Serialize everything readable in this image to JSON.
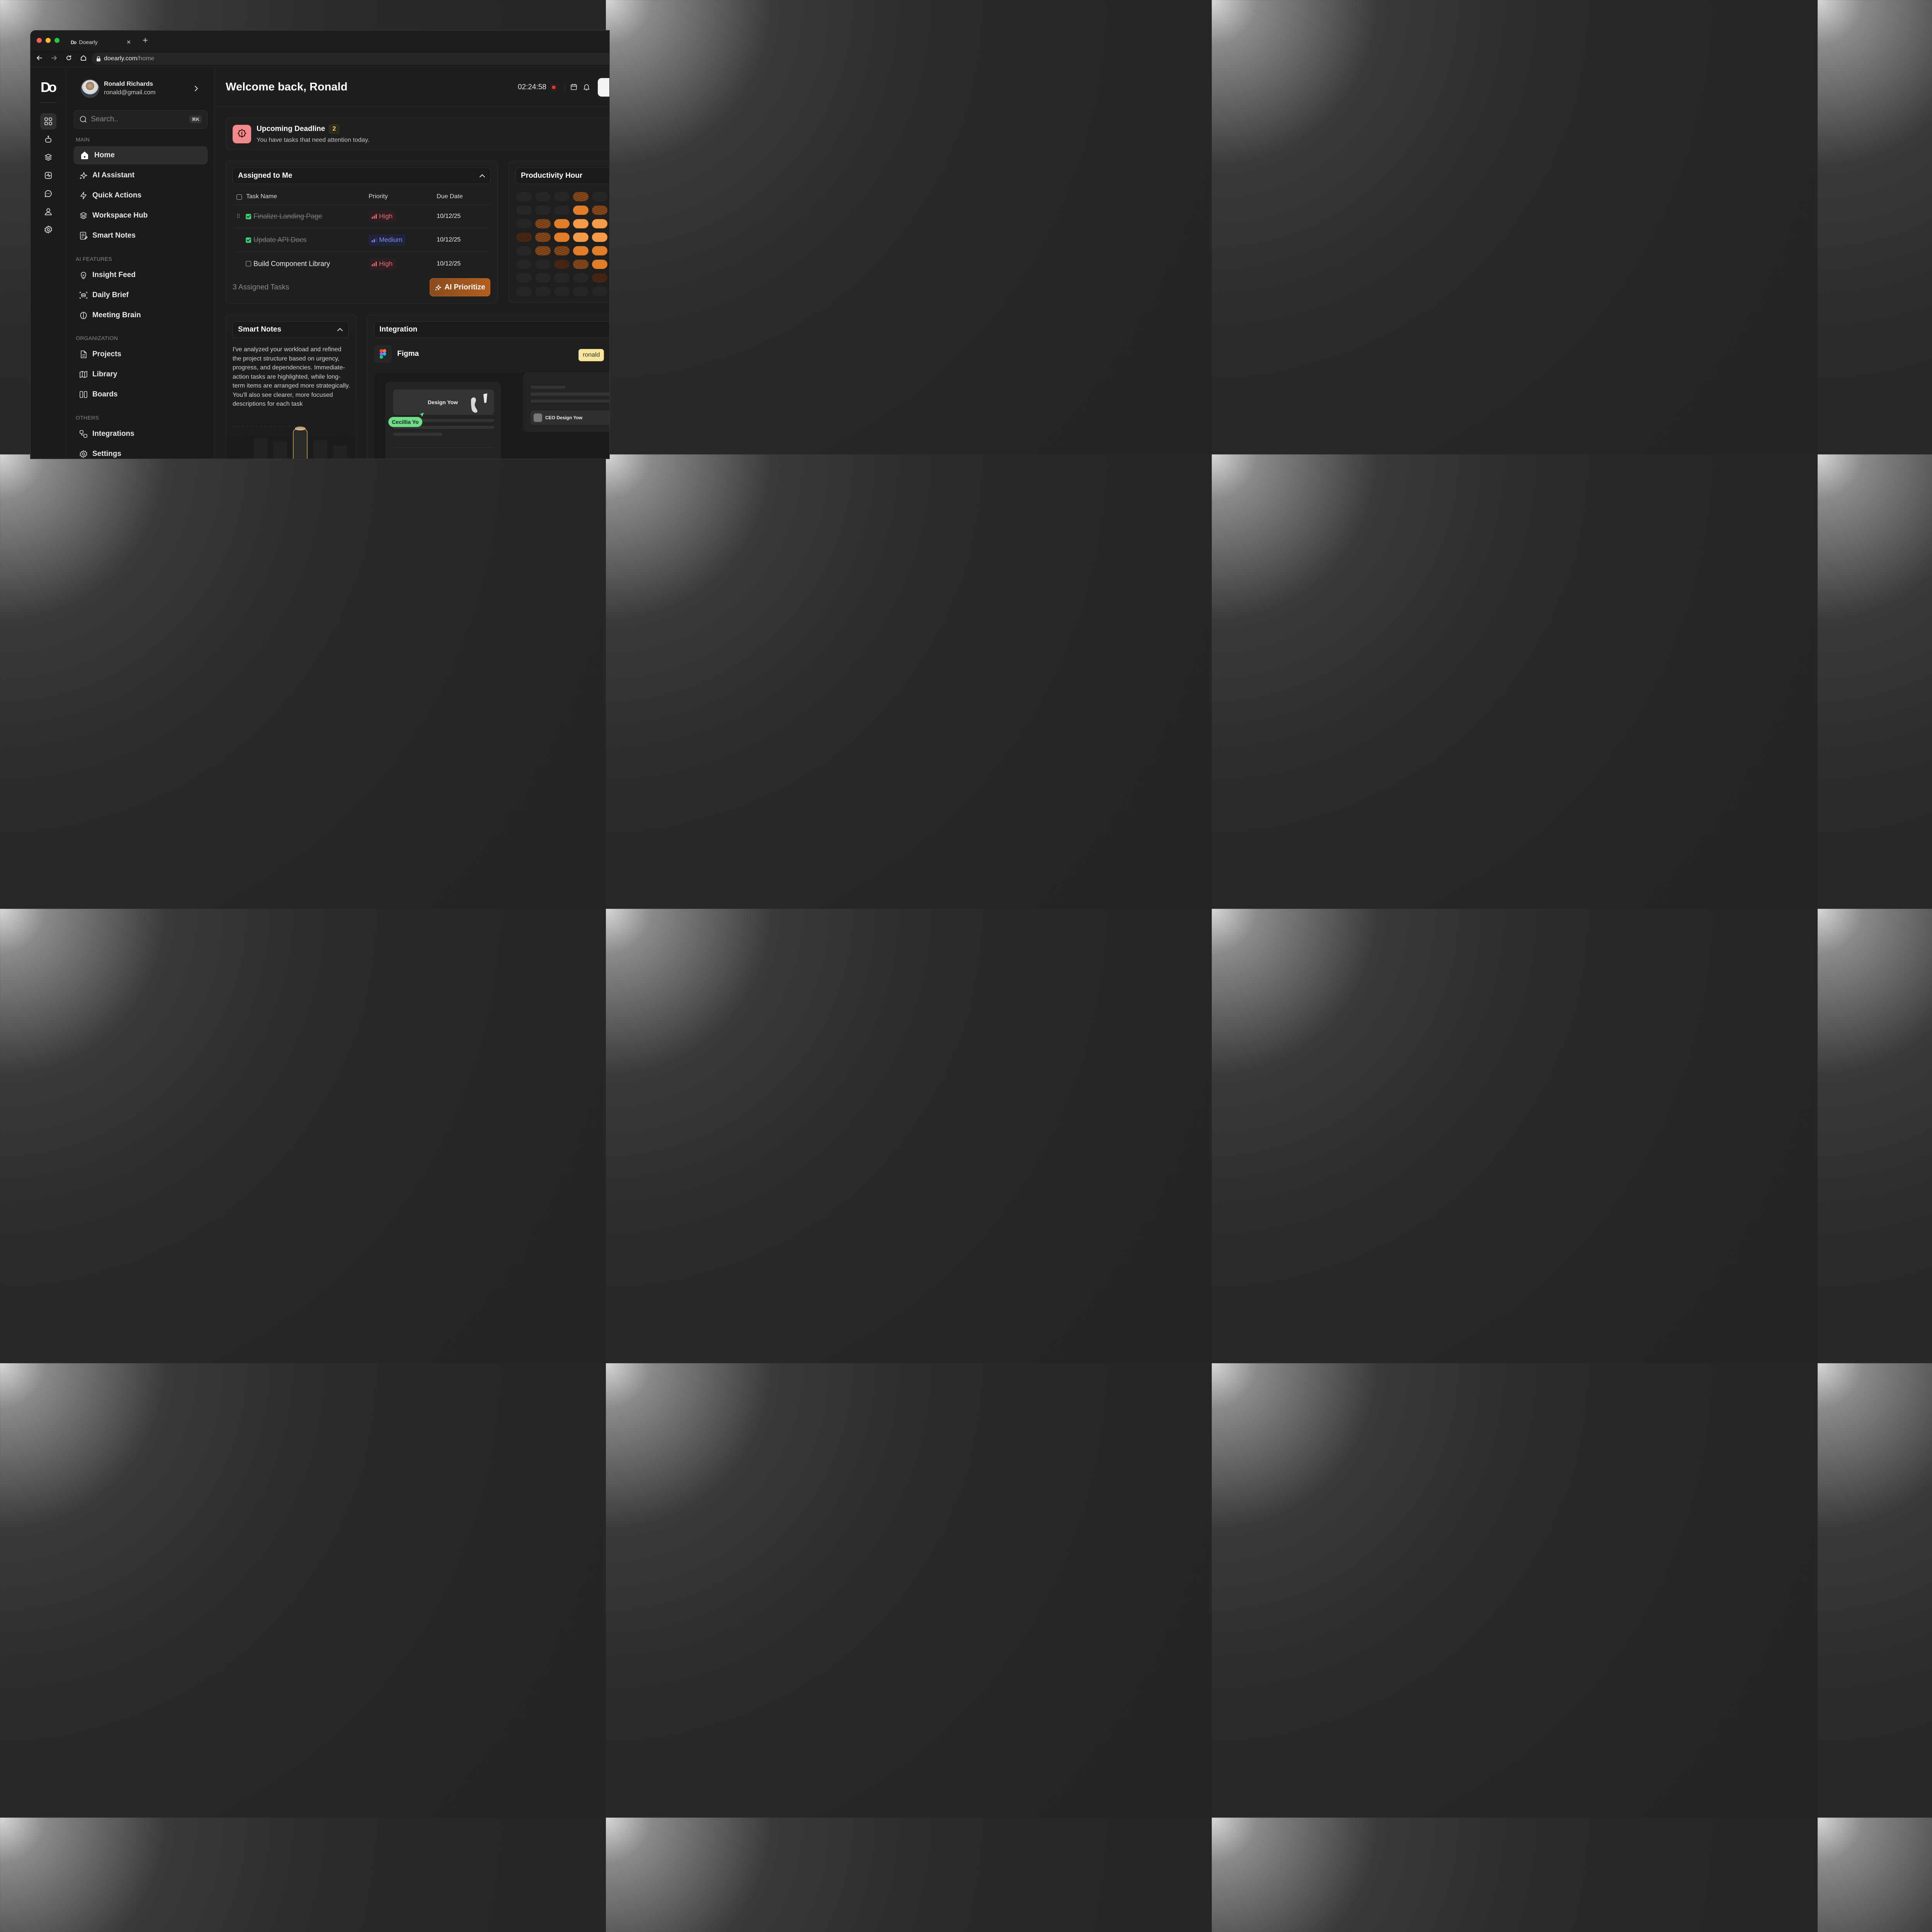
{
  "browser": {
    "tab_title": "Doearly",
    "url_host": "doearly.com",
    "url_path": "/home"
  },
  "rail": {
    "logo": "Do",
    "icons": [
      "grid-icon",
      "robot-icon",
      "layers-icon",
      "activity-icon",
      "chat-icon",
      "user-icon",
      "gear-icon"
    ]
  },
  "profile": {
    "name": "Ronald Richards",
    "email": "ronald@gmail.com"
  },
  "search": {
    "placeholder": "Search..",
    "shortcut": "⌘K"
  },
  "sidebar": {
    "main_label": "MAIN",
    "main_items": [
      {
        "label": "Home",
        "icon": "home-icon",
        "active": true
      },
      {
        "label": "AI Assistant",
        "icon": "sparkle-icon"
      },
      {
        "label": "Quick Actions",
        "icon": "bolt-icon"
      },
      {
        "label": "Workspace Hub",
        "icon": "layers-icon"
      },
      {
        "label": "Smart Notes",
        "icon": "notes-icon"
      }
    ],
    "ai_label": "AI FEATURES",
    "ai_items": [
      {
        "label": "Insight Feed",
        "icon": "bulb-icon"
      },
      {
        "label": "Daily Brief",
        "icon": "bot-scan-icon"
      },
      {
        "label": "Meeting Brain",
        "icon": "brain-icon"
      }
    ],
    "org_label": "ORGANIZATION",
    "org_items": [
      {
        "label": "Projects",
        "icon": "document-icon"
      },
      {
        "label": "Library",
        "icon": "book-icon"
      },
      {
        "label": "Boards",
        "icon": "columns-icon"
      }
    ],
    "others_label": "OTHERS",
    "others_items": [
      {
        "label": "Integrations",
        "icon": "integrations-icon"
      },
      {
        "label": "Settings",
        "icon": "gear-icon"
      }
    ]
  },
  "header": {
    "welcome": "Welcome back, Ronald",
    "timer": "02:24:58"
  },
  "deadline": {
    "title": "Upcoming Deadline",
    "count": "2",
    "subtitle": "You have tasks that need attention today."
  },
  "assigned": {
    "title": "Assigned to Me",
    "columns": {
      "task": "Task Name",
      "priority": "Priority",
      "due": "Due Date"
    },
    "rows": [
      {
        "task": "Finalize Landing Page",
        "priority": "High",
        "due": "10/12/25",
        "done": true
      },
      {
        "task": "Update API Docs",
        "priority": "Medium",
        "due": "10/12/25",
        "done": true
      },
      {
        "task": "Build Component Library",
        "priority": "High",
        "due": "10/12/25",
        "done": false
      }
    ],
    "count_label": "3 Assigned Tasks",
    "ai_button": "AI Prioritize"
  },
  "productivity": {
    "title": "Productivity Hour"
  },
  "smart_notes": {
    "title": "Smart Notes",
    "body": "I've analyzed your workload and refined the project structure based on urgency, progress, and dependencies. Immediate-action tasks are highlighted, while long-term items are arranged more strategically. You'll also see clearer, more focused descriptions for each task"
  },
  "integration": {
    "title": "Integration",
    "app": "Figma",
    "user_chip": "ronald",
    "preview_card": "Design Yow",
    "cursor_label": "Cecillia Yo",
    "ceo_chip": "CEO Design Yow"
  },
  "colors": {
    "accent_orange": "#f29540",
    "high": "#ee6d73",
    "medium": "#7b8ff0",
    "done_green": "#3fd17a"
  }
}
